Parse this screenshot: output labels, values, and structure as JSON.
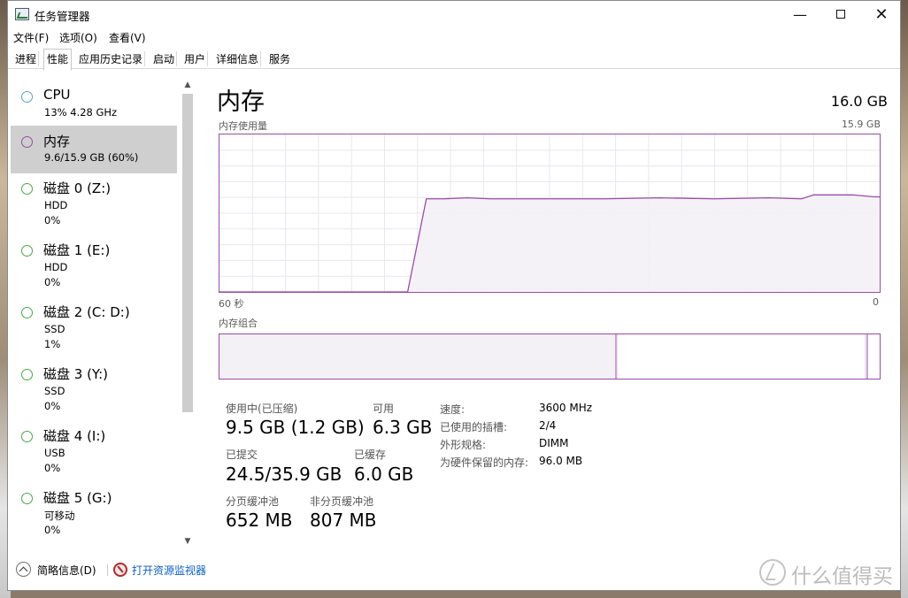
{
  "window": {
    "title": "任务管理器",
    "minimize": "—",
    "close": "✕"
  },
  "menubar": [
    "文件(F)",
    "选项(O)",
    "查看(V)"
  ],
  "tabs": [
    "进程",
    "性能",
    "应用历史记录",
    "启动",
    "用户",
    "详细信息",
    "服务"
  ],
  "active_tab": "性能",
  "sidebar": {
    "items": [
      {
        "name": "CPU",
        "detail": "13%  4.28 GHz",
        "kind": "cpu"
      },
      {
        "name": "内存",
        "detail": "9.6/15.9 GB (60%)",
        "kind": "memory",
        "selected": true
      },
      {
        "name": "磁盘 0 (Z:)",
        "type": "HDD",
        "usage": "0%"
      },
      {
        "name": "磁盘 1 (E:)",
        "type": "HDD",
        "usage": "0%"
      },
      {
        "name": "磁盘 2 (C: D:)",
        "type": "SSD",
        "usage": "1%"
      },
      {
        "name": "磁盘 3 (Y:)",
        "type": "SSD",
        "usage": "0%"
      },
      {
        "name": "磁盘 4 (I:)",
        "type": "USB",
        "usage": "0%"
      },
      {
        "name": "磁盘 5 (G:)",
        "type": "可移动",
        "usage": "0%"
      }
    ]
  },
  "main": {
    "title": "内存",
    "total": "16.0 GB",
    "usage_graph": {
      "label": "内存使用量",
      "max_label": "15.9 GB",
      "x_left_label": "60 秒",
      "x_right_label": "0",
      "accent_color": "#9b4ba8",
      "fill_color": "#f4f1f6",
      "grid_color": "#ebe6ee"
    },
    "composition": {
      "label": "内存组合"
    },
    "stats": {
      "in_use_label": "使用中(已压缩)",
      "in_use_value": "9.5 GB (1.2 GB)",
      "available_label": "可用",
      "available_value": "6.3 GB",
      "committed_label": "已提交",
      "committed_value": "24.5/35.9 GB",
      "cached_label": "已缓存",
      "cached_value": "6.0 GB",
      "paged_pool_label": "分页缓冲池",
      "paged_pool_value": "652 MB",
      "nonpaged_pool_label": "非分页缓冲池",
      "nonpaged_pool_value": "807 MB"
    },
    "details": [
      {
        "key": "速度:",
        "value": "3600 MHz"
      },
      {
        "key": "已使用的插槽:",
        "value": "2/4"
      },
      {
        "key": "外形规格:",
        "value": "DIMM"
      },
      {
        "key": "为硬件保留的内存:",
        "value": "96.0 MB"
      }
    ]
  },
  "chart_data": {
    "type": "area",
    "title": "内存使用量",
    "xlabel": "",
    "ylabel": "",
    "x_range_seconds": [
      60,
      0
    ],
    "ylim_gb": [
      0,
      15.9
    ],
    "grid": true,
    "series": [
      {
        "x": [
          60,
          42.9,
          41.2,
          39.6,
          37.5,
          35.4,
          30.0,
          25.0,
          20.0,
          15.0,
          10.0,
          7.1,
          6.0,
          2.5,
          0.5,
          0
        ],
        "values": [
          0,
          0,
          9.4,
          9.4,
          9.5,
          9.4,
          9.4,
          9.4,
          9.5,
          9.4,
          9.5,
          9.4,
          9.8,
          9.8,
          9.6,
          9.6
        ]
      }
    ]
  },
  "footer": {
    "fewer_details": "简略信息(D)",
    "open_resource_monitor": "打开资源监视器"
  },
  "watermark": "值 什么值得买"
}
